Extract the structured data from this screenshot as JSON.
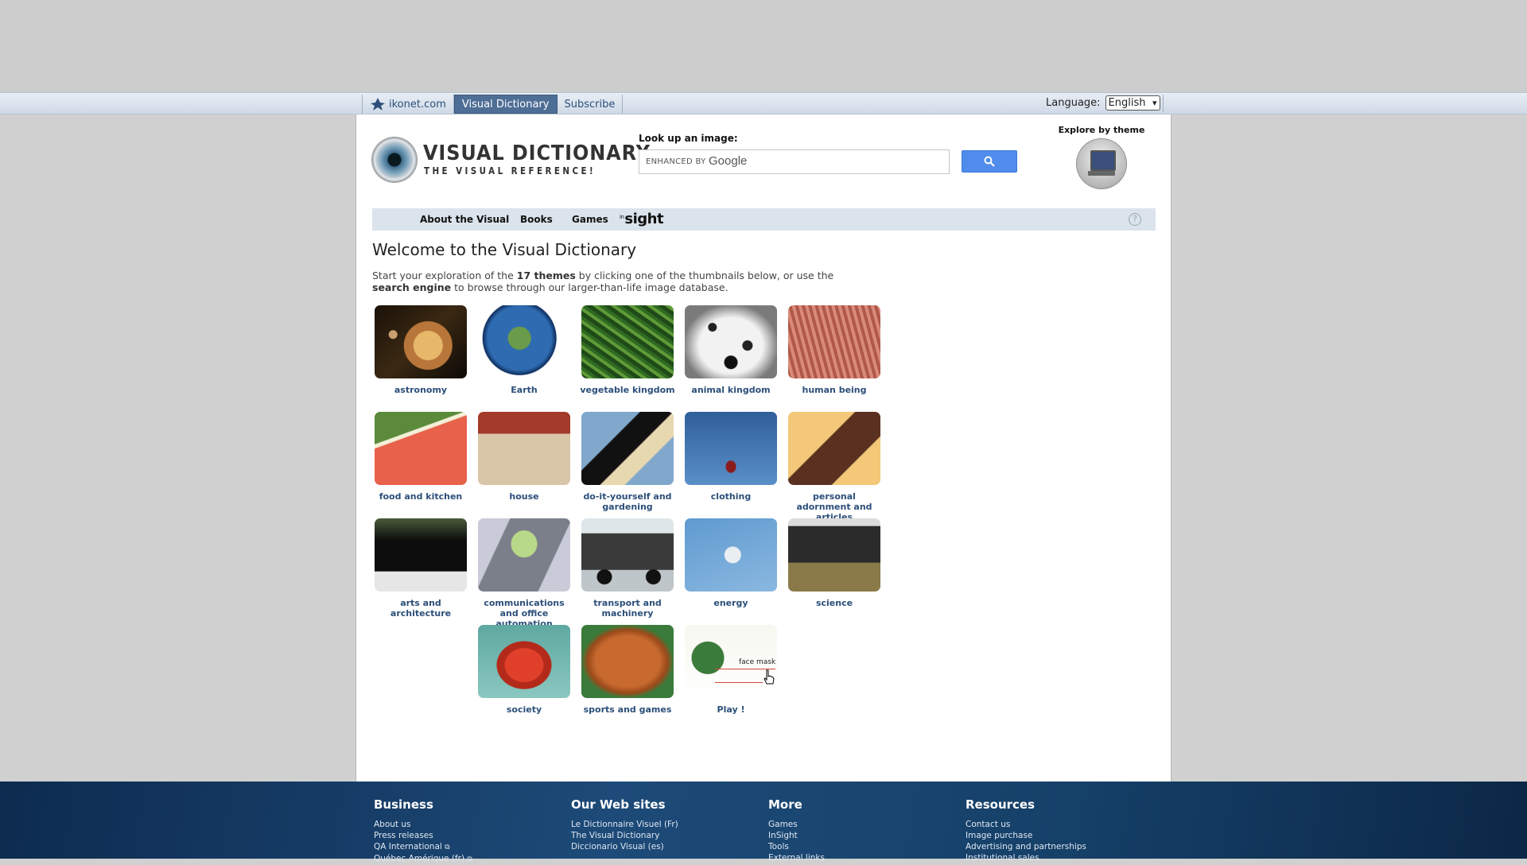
{
  "topbar": {
    "tabs": [
      {
        "label": "ikonet.com",
        "active": false
      },
      {
        "label": "Visual Dictionary",
        "active": true
      },
      {
        "label": "Subscribe",
        "active": false
      }
    ],
    "language_label": "Language:",
    "language_value": "English"
  },
  "header": {
    "brand_title": "VISUAL DICTIONARY",
    "brand_tagline": "THE VISUAL REFERENCE!",
    "lookup_label": "Look up an image:",
    "search_prefix": "ENHANCED BY",
    "search_brand": "Google",
    "explore_label": "Explore by theme"
  },
  "nav": {
    "items": [
      "About the Visual",
      "Books",
      "Games"
    ],
    "insight_prefix": "in",
    "insight_label": "sight",
    "help": "?"
  },
  "main": {
    "title": "Welcome to the Visual Dictionary",
    "intro_1": "Start your exploration of the ",
    "intro_bold_1": "17 themes",
    "intro_2": " by clicking one of the thumbnails below, or use the ",
    "intro_bold_2": "search engine",
    "intro_3": " to browse through our larger-than-life image database.",
    "themes": [
      {
        "label": "astronomy",
        "icon": "astronomy-image"
      },
      {
        "label": "Earth",
        "icon": "earth-image"
      },
      {
        "label": "vegetable kingdom",
        "icon": "vegetable-image"
      },
      {
        "label": "animal kingdom",
        "icon": "animal-image"
      },
      {
        "label": "human being",
        "icon": "human-image"
      },
      {
        "label": "food and kitchen",
        "icon": "food-image"
      },
      {
        "label": "house",
        "icon": "house-image"
      },
      {
        "label": "do-it-yourself and gardening",
        "icon": "diy-image"
      },
      {
        "label": "clothing",
        "icon": "clothing-image"
      },
      {
        "label": "personal adornment and articles",
        "icon": "adornment-image"
      },
      {
        "label": "arts and architecture",
        "icon": "arts-image"
      },
      {
        "label": "communications and office automation",
        "icon": "communications-image"
      },
      {
        "label": "transport and machinery",
        "icon": "transport-image"
      },
      {
        "label": "energy",
        "icon": "energy-image"
      },
      {
        "label": "science",
        "icon": "science-image"
      },
      {
        "label": "society",
        "icon": "society-image"
      },
      {
        "label": "sports and games",
        "icon": "sports-image"
      },
      {
        "label": "Play !",
        "icon": "play-image",
        "caption": "face mask"
      }
    ]
  },
  "footer": {
    "business": {
      "title": "Business",
      "links": [
        "About us",
        "Press releases",
        "QA International",
        "Québec Amérique (fr)"
      ]
    },
    "websites": {
      "title": "Our Web sites",
      "links": [
        "Le Dictionnaire Visuel (Fr)",
        "The Visual Dictionary",
        "Diccionario Visual (es)"
      ]
    },
    "more": {
      "title": "More",
      "links": [
        "Games",
        "InSight",
        "Tools",
        "External links"
      ]
    },
    "resources": {
      "title": "Resources",
      "links": [
        "Contact us",
        "Image purchase",
        "Advertising and partnerships",
        "Institutional sales"
      ]
    }
  },
  "colors": {
    "link": "#2c4f7a",
    "active_tab": "#4e6e95",
    "search_button": "#4f8ceb",
    "footer": "#1d4a78"
  }
}
